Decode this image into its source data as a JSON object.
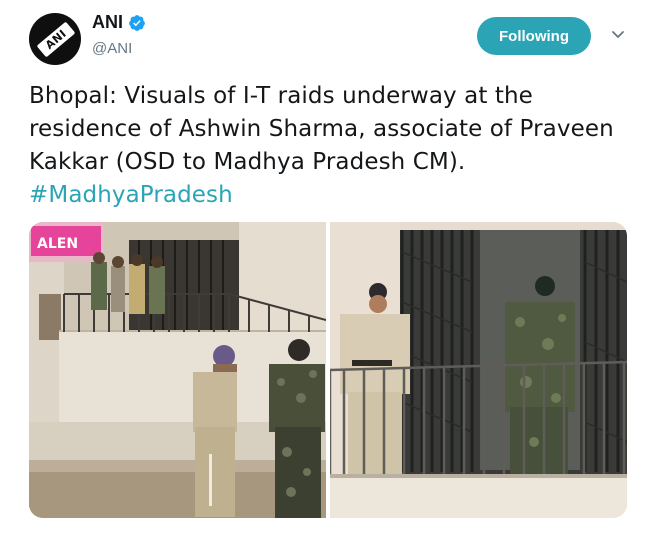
{
  "account": {
    "display_name": "ANI",
    "handle": "@ANI",
    "verified": true,
    "avatar_logo_text": "ANI"
  },
  "follow_button": {
    "label": "Following",
    "color": "#2ba5b5"
  },
  "menu": {
    "icon": "chevron-down-icon"
  },
  "tweet": {
    "text": "Bhopal: Visuals of I-T raids underway at the residence of Ashwin Sharma, associate of Praveen Kakkar (OSD to Madhya Pradesh CM).",
    "hashtag": "#MadhyaPradesh",
    "link_color": "#2ba5b5"
  },
  "media": {
    "photos": [
      {
        "name": "left-photo",
        "sign_text": "ALEN"
      },
      {
        "name": "right-photo"
      }
    ]
  },
  "colors": {
    "text": "#14171a",
    "muted": "#657786",
    "verified": "#1da1f2"
  }
}
